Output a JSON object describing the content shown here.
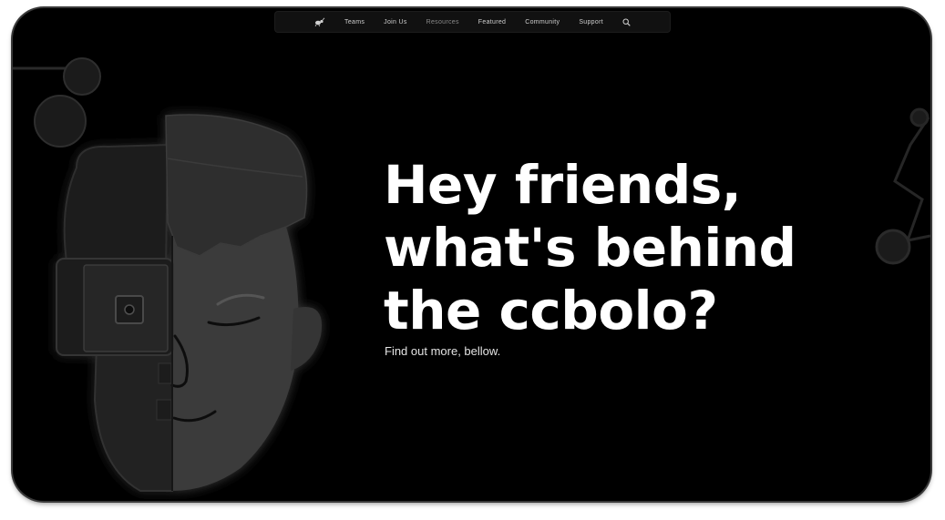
{
  "nav": {
    "logo_icon": "ant-logo-icon",
    "items": [
      {
        "label": "Teams"
      },
      {
        "label": "Join Us"
      },
      {
        "label": "Resources",
        "muted": true
      },
      {
        "label": "Featured"
      },
      {
        "label": "Community"
      },
      {
        "label": "Support"
      }
    ],
    "search_icon": "search-icon"
  },
  "hero": {
    "title_lines": [
      "Hey friends,",
      "what's behind",
      "the ccbolo?"
    ],
    "subtitle": "Find out more, bellow."
  },
  "colors": {
    "background": "#000000",
    "text": "#ffffff",
    "nav_bg": "#111111",
    "illustration_grey": "#3a3a3a"
  }
}
